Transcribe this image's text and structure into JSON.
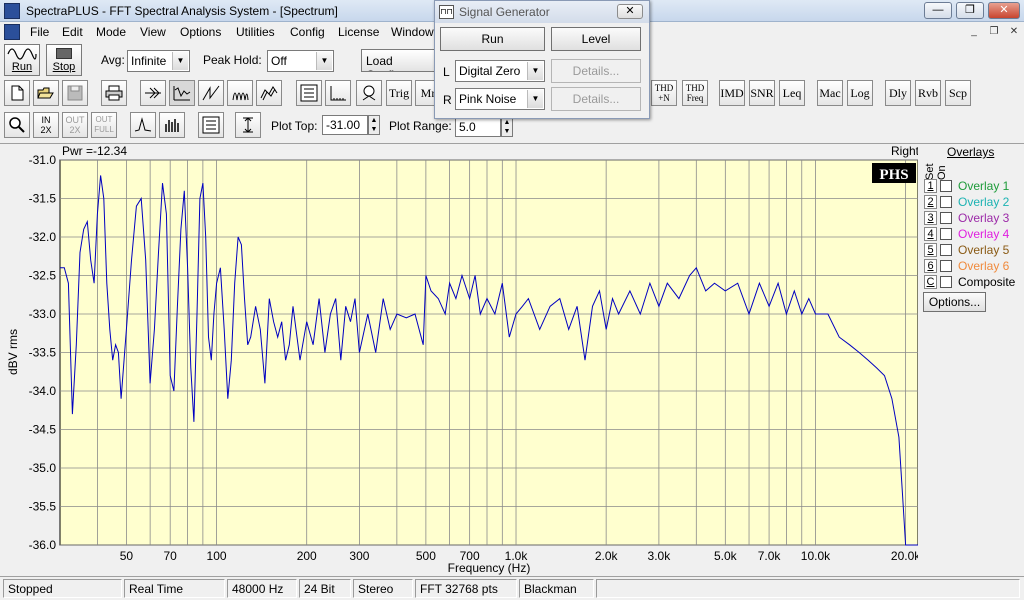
{
  "window": {
    "title": "SpectraPLUS - FFT Spectral Analysis System - [Spectrum]",
    "min": "—",
    "max": "❐",
    "close": "✕",
    "mdi_min": "_",
    "mdi_restore": "❐",
    "mdi_close": "✕"
  },
  "menu": [
    "File",
    "Edit",
    "Mode",
    "View",
    "Options",
    "Utilities",
    "Config",
    "License",
    "Window"
  ],
  "toolbar1": {
    "run_label": "Run",
    "stop_label": "Stop",
    "avg_label": "Avg:",
    "avg_value": "Infinite",
    "peak_label": "Peak Hold:",
    "peak_value": "Off",
    "load_config": "Load Configu"
  },
  "toolbar2": {
    "trig": "Trig",
    "mr": "Mr",
    "thd_n": [
      "THD",
      "+N"
    ],
    "thd_freq": [
      "THD",
      "Freq"
    ],
    "imd": "IMD",
    "snr": "SNR",
    "leq": "Leq",
    "mac": "Mac",
    "log": "Log",
    "dly": "Dly",
    "rvb": "Rvb",
    "scp": "Scp"
  },
  "toolbar3": {
    "zoom_in": [
      "IN",
      "2X"
    ],
    "zoom_out": [
      "OUT",
      "2X"
    ],
    "zoom_full": [
      "OUT",
      "FULL"
    ],
    "plot_top_label": "Plot Top:",
    "plot_top_value": "-31.00",
    "plot_range_label": "Plot Range:",
    "plot_range_value": "5.0"
  },
  "signal_generator": {
    "title": "Signal Generator",
    "close": "✕",
    "run": "Run",
    "level": "Level",
    "left_label": "L",
    "left_value": "Digital Zero",
    "right_label": "R",
    "right_value": "Pink Noise",
    "details": "Details..."
  },
  "plot": {
    "pwr": "Pwr =-12.34",
    "channel": "Right",
    "logo": "PHS",
    "bg_color": "#ffffcf",
    "trace_color": "#0000c0"
  },
  "overlays": {
    "header": "Overlays",
    "set_label": "Set",
    "on_label": "On",
    "items": [
      {
        "num": "1",
        "label": "Overlay 1",
        "color": "#1e9b3a"
      },
      {
        "num": "2",
        "label": "Overlay 2",
        "color": "#1db3b3"
      },
      {
        "num": "3",
        "label": "Overlay 3",
        "color": "#9c2aa8"
      },
      {
        "num": "4",
        "label": "Overlay 4",
        "color": "#e01ee0"
      },
      {
        "num": "5",
        "label": "Overlay 5",
        "color": "#8a5a14"
      },
      {
        "num": "6",
        "label": "Overlay 6",
        "color": "#f08a3c"
      },
      {
        "num": "C",
        "label": "Composite",
        "color": "#000000"
      }
    ],
    "options": "Options..."
  },
  "status": [
    "Stopped",
    "Real Time",
    "48000 Hz",
    "24 Bit",
    "Stereo",
    "FFT 32768 pts",
    "Blackman"
  ],
  "chart_data": {
    "type": "line",
    "xlabel": "Frequency (Hz)",
    "ylabel": "dBV rms",
    "x_scale": "log",
    "xlim": [
      30,
      22000
    ],
    "ylim": [
      -36.0,
      -31.0
    ],
    "x_tick_labels": [
      {
        "v": 50,
        "t": "50"
      },
      {
        "v": 70,
        "t": "70"
      },
      {
        "v": 100,
        "t": "100"
      },
      {
        "v": 200,
        "t": "200"
      },
      {
        "v": 300,
        "t": "300"
      },
      {
        "v": 500,
        "t": "500"
      },
      {
        "v": 700,
        "t": "700"
      },
      {
        "v": 1000,
        "t": "1.0k"
      },
      {
        "v": 2000,
        "t": "2.0k"
      },
      {
        "v": 3000,
        "t": "3.0k"
      },
      {
        "v": 5000,
        "t": "5.0k"
      },
      {
        "v": 7000,
        "t": "7.0k"
      },
      {
        "v": 10000,
        "t": "10.0k"
      },
      {
        "v": 20000,
        "t": "20.0k"
      }
    ],
    "y_ticks": [
      -31.0,
      -31.5,
      -32.0,
      -32.5,
      -33.0,
      -33.5,
      -34.0,
      -34.5,
      -35.0,
      -35.5,
      -36.0
    ],
    "y_tick_labels": [
      "-31.0",
      "-31.5",
      "-32.0",
      "-32.5",
      "-33.0",
      "-33.5",
      "-34.0",
      "-34.5",
      "-35.0",
      "-35.5",
      "-36.0"
    ],
    "grid": true,
    "series": [
      {
        "x": [
          30,
          31,
          32,
          33,
          34,
          35,
          36,
          37,
          38,
          39,
          40,
          41,
          42,
          43,
          44,
          45,
          46,
          47,
          48,
          50,
          52,
          54,
          56,
          58,
          60,
          62,
          64,
          66,
          68,
          70,
          72,
          74,
          76,
          78,
          80,
          82,
          84,
          86,
          88,
          90,
          92,
          94,
          96,
          98,
          100,
          103,
          106,
          109,
          112,
          115,
          118,
          121,
          124,
          127,
          130,
          135,
          140,
          145,
          150,
          155,
          160,
          165,
          170,
          175,
          180,
          190,
          200,
          210,
          220,
          230,
          240,
          250,
          260,
          270,
          280,
          290,
          300,
          320,
          340,
          360,
          380,
          400,
          430,
          460,
          490,
          500,
          520,
          550,
          580,
          600,
          630,
          660,
          700,
          730,
          760,
          800,
          850,
          900,
          950,
          1000,
          1050,
          1100,
          1200,
          1300,
          1400,
          1500,
          1600,
          1700,
          1800,
          1900,
          2000,
          2100,
          2200,
          2400,
          2600,
          2800,
          3000,
          3200,
          3500,
          3800,
          4000,
          4300,
          4600,
          5000,
          5500,
          6000,
          6500,
          7000,
          7500,
          8000,
          8500,
          9000,
          9500,
          10000,
          11000,
          12000,
          13000,
          14000,
          15000,
          16000,
          17000,
          18000,
          19000,
          19500,
          20000,
          20500,
          21000,
          21500,
          22000
        ],
        "y": [
          -32.4,
          -32.4,
          -32.6,
          -34.3,
          -33.4,
          -32.2,
          -31.9,
          -31.8,
          -32.3,
          -32.6,
          -31.7,
          -31.2,
          -31.5,
          -32.6,
          -33.2,
          -33.6,
          -33.4,
          -33.5,
          -34.1,
          -33.2,
          -32.3,
          -31.6,
          -31.5,
          -32.3,
          -33.9,
          -33.2,
          -32.2,
          -31.3,
          -31.7,
          -33.8,
          -34.0,
          -32.9,
          -31.9,
          -31.4,
          -32.4,
          -33.7,
          -34.4,
          -33.0,
          -31.5,
          -31.3,
          -32.0,
          -33.3,
          -33.6,
          -33.0,
          -32.6,
          -32.4,
          -33.2,
          -34.1,
          -33.6,
          -32.6,
          -32.0,
          -32.1,
          -32.8,
          -33.4,
          -33.3,
          -32.9,
          -33.2,
          -33.9,
          -32.8,
          -33.1,
          -33.3,
          -33.1,
          -33.6,
          -33.4,
          -32.9,
          -33.6,
          -33.1,
          -33.4,
          -32.8,
          -33.5,
          -33.0,
          -32.8,
          -33.6,
          -32.9,
          -33.1,
          -32.8,
          -33.5,
          -33.0,
          -33.5,
          -32.8,
          -33.2,
          -33.0,
          -33.05,
          -33.0,
          -33.4,
          -32.5,
          -32.7,
          -32.8,
          -33.0,
          -32.6,
          -32.8,
          -32.5,
          -32.8,
          -32.5,
          -33.0,
          -32.8,
          -33.0,
          -32.6,
          -33.3,
          -33.0,
          -32.9,
          -32.8,
          -33.2,
          -32.9,
          -32.8,
          -33.2,
          -32.9,
          -33.6,
          -32.9,
          -32.7,
          -33.2,
          -32.8,
          -33.0,
          -32.7,
          -33.0,
          -32.6,
          -32.9,
          -32.6,
          -32.8,
          -32.5,
          -32.4,
          -32.7,
          -32.6,
          -32.7,
          -32.6,
          -33.0,
          -32.6,
          -32.9,
          -32.6,
          -33.0,
          -32.7,
          -33.0,
          -32.8,
          -33.0,
          -33.0,
          -33.3,
          -33.4,
          -33.5,
          -33.6,
          -33.7,
          -33.8,
          -34.1,
          -34.6,
          -35.3,
          -36.0,
          -36.0,
          -36.0,
          -36.0,
          -36.0
        ]
      }
    ]
  }
}
